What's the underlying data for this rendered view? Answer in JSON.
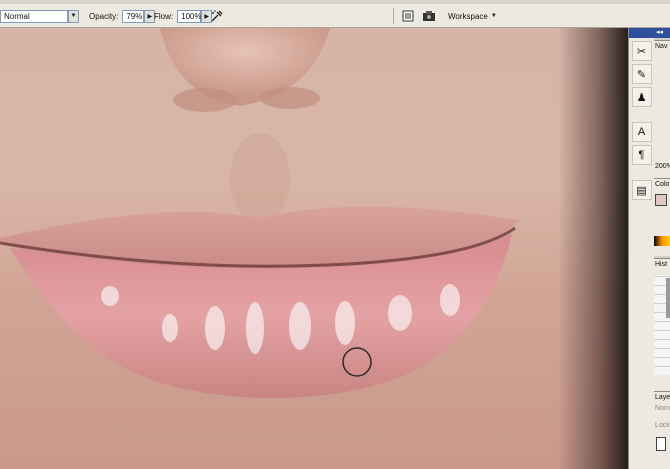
{
  "options_bar": {
    "mode_value": "Normal",
    "opacity_label": "Opacity:",
    "opacity_value": "79%",
    "flow_label": "Flow:",
    "flow_value": "100%",
    "workspace_label": "Workspace"
  },
  "palettes": {
    "navigator_tab": "Nav",
    "zoom_value": "200%",
    "color_tab": "Colo",
    "history_tab": "Hist",
    "layers_tab": "Laye",
    "layers_blend": "Norn",
    "layers_lock": "Lock"
  },
  "icons": {
    "airbrush": "airbrush-icon",
    "file_browser": "file-browser-icon",
    "palette_well": "palette-well-icon"
  }
}
